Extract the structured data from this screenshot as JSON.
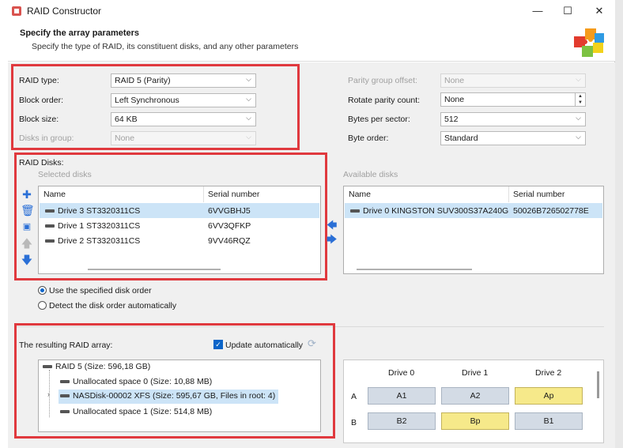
{
  "window": {
    "title": "RAID Constructor",
    "min_glyph": "—",
    "max_glyph": "☐",
    "close_glyph": "✕"
  },
  "header": {
    "title": "Specify the array parameters",
    "subtitle": "Specify the type of RAID, its constituent disks, and any other parameters",
    "logo_icon": "puzzle-icon"
  },
  "params_left": [
    {
      "label": "RAID type:",
      "value": "RAID 5 (Parity)",
      "enabled": true
    },
    {
      "label": "Block order:",
      "value": "Left Synchronous",
      "enabled": true
    },
    {
      "label": "Block size:",
      "value": "64 KB",
      "enabled": true
    },
    {
      "label": "Disks in group:",
      "value": "None",
      "enabled": false
    }
  ],
  "params_right": [
    {
      "label": "Parity group offset:",
      "value": "None",
      "enabled": false,
      "kind": "combo"
    },
    {
      "label": "Rotate parity count:",
      "value": "None",
      "enabled": true,
      "kind": "spin"
    },
    {
      "label": "Bytes per sector:",
      "value": "512",
      "enabled": true,
      "kind": "combo"
    },
    {
      "label": "Byte order:",
      "value": "Standard",
      "enabled": true,
      "kind": "combo"
    }
  ],
  "raid_disks": {
    "label": "RAID Disks:",
    "selected_label": "Selected disks",
    "available_label": "Available disks",
    "columns": [
      "Name",
      "Serial number"
    ],
    "selected": [
      {
        "name": "Drive 3 ST3320311CS",
        "serial": "6VVGBHJ5"
      },
      {
        "name": "Drive 1 ST3320311CS",
        "serial": "6VV3QFKP"
      },
      {
        "name": "Drive 2 ST3320311CS",
        "serial": "9VV46RQZ"
      }
    ],
    "available": [
      {
        "name": "Drive 0 KINGSTON SUV300S37A240G",
        "serial": "50026B726502778E"
      }
    ]
  },
  "disk_order": {
    "specified": "Use the specified disk order",
    "auto": "Detect the disk order automatically"
  },
  "result": {
    "label": "The resulting RAID array:",
    "update_label": "Update automatically",
    "tree": [
      "RAID 5 (Size: 596,18 GB)",
      "Unallocated space 0 (Size: 10,88 MB)",
      "NASDisk-00002 XFS (Size: 595,67 GB, Files in root: 4)",
      "Unallocated space 1 (Size: 514,8 MB)"
    ]
  },
  "layout_grid": {
    "drives": [
      "Drive 0",
      "Drive 1",
      "Drive 2"
    ],
    "rows": [
      {
        "label": "A",
        "cells": [
          "A1",
          "A2",
          "Ap"
        ]
      },
      {
        "label": "B",
        "cells": [
          "B2",
          "Bp",
          "B1"
        ]
      }
    ]
  },
  "colors": {
    "highlight_red": "#e0393e",
    "selection": "#cce4f7",
    "parity_block": "#f6e98a",
    "data_block": "#d3dbe5",
    "accent": "#0a64c8"
  }
}
